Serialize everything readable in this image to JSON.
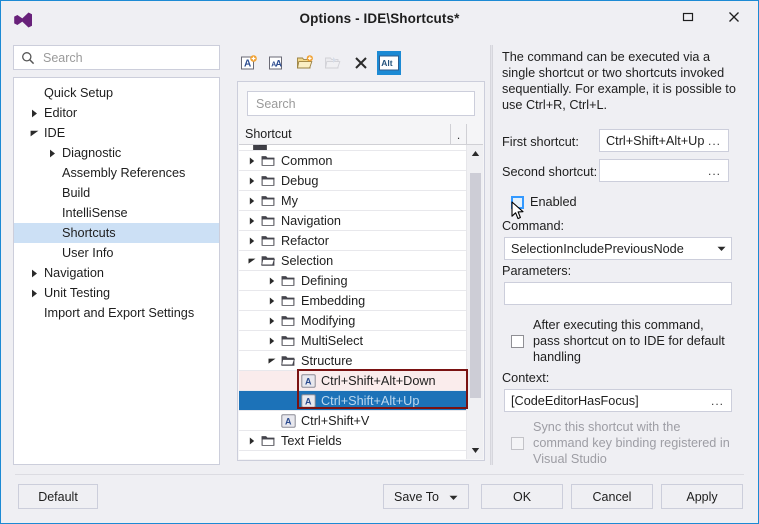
{
  "window": {
    "title": "Options - IDE\\Shortcuts*",
    "logo_icon": "visual-studio-logo",
    "maximize_icon": "maximize-icon",
    "close_icon": "close-icon"
  },
  "nav": {
    "search": {
      "placeholder": "Search",
      "value": "",
      "icon": "search-icon"
    },
    "items": [
      {
        "label": "Quick Setup",
        "indent": 0,
        "expander": "none",
        "selected": false
      },
      {
        "label": "Editor",
        "indent": 0,
        "expander": "collapsed",
        "selected": false
      },
      {
        "label": "IDE",
        "indent": 0,
        "expander": "expanded",
        "selected": false
      },
      {
        "label": "Diagnostic",
        "indent": 1,
        "expander": "collapsed",
        "selected": false
      },
      {
        "label": "Assembly References",
        "indent": 1,
        "expander": "none",
        "selected": false
      },
      {
        "label": "Build",
        "indent": 1,
        "expander": "none",
        "selected": false
      },
      {
        "label": "IntelliSense",
        "indent": 1,
        "expander": "none",
        "selected": false
      },
      {
        "label": "Shortcuts",
        "indent": 1,
        "expander": "none",
        "selected": true
      },
      {
        "label": "User Info",
        "indent": 1,
        "expander": "none",
        "selected": false
      },
      {
        "label": "Navigation",
        "indent": 0,
        "expander": "collapsed",
        "selected": false
      },
      {
        "label": "Unit Testing",
        "indent": 0,
        "expander": "collapsed",
        "selected": false
      },
      {
        "label": "Import and Export Settings",
        "indent": 0,
        "expander": "none",
        "selected": false
      }
    ]
  },
  "middle": {
    "toolbar": [
      {
        "name": "add-shortcut-icon",
        "enabled": true,
        "active": false
      },
      {
        "name": "add-folder-icon",
        "enabled": true,
        "active": false
      },
      {
        "name": "open-folder-icon",
        "enabled": true,
        "active": false
      },
      {
        "name": "copy-shortcut-icon",
        "enabled": false,
        "active": false
      },
      {
        "name": "delete-icon",
        "enabled": true,
        "active": false
      },
      {
        "name": "alt-toggle-icon",
        "enabled": true,
        "active": true,
        "label": "Alt"
      }
    ],
    "search": {
      "placeholder": "Search",
      "value": ""
    },
    "column_header": {
      "main": "Shortcut",
      "secondary": "."
    },
    "tree": [
      {
        "label": "Common",
        "indent": 0,
        "expander": "collapsed",
        "icon": "folder-icon",
        "state": "normal"
      },
      {
        "label": "Debug",
        "indent": 0,
        "expander": "collapsed",
        "icon": "folder-icon",
        "state": "normal"
      },
      {
        "label": "My",
        "indent": 0,
        "expander": "collapsed",
        "icon": "folder-icon",
        "state": "normal"
      },
      {
        "label": "Navigation",
        "indent": 0,
        "expander": "collapsed",
        "icon": "folder-icon",
        "state": "normal"
      },
      {
        "label": "Refactor",
        "indent": 0,
        "expander": "collapsed",
        "icon": "folder-icon",
        "state": "normal"
      },
      {
        "label": "Selection",
        "indent": 0,
        "expander": "expanded",
        "icon": "folder-open-icon",
        "state": "normal"
      },
      {
        "label": "Defining",
        "indent": 1,
        "expander": "collapsed",
        "icon": "folder-icon",
        "state": "normal"
      },
      {
        "label": "Embedding",
        "indent": 1,
        "expander": "collapsed",
        "icon": "folder-icon",
        "state": "normal"
      },
      {
        "label": "Modifying",
        "indent": 1,
        "expander": "collapsed",
        "icon": "folder-icon",
        "state": "normal"
      },
      {
        "label": "MultiSelect",
        "indent": 1,
        "expander": "collapsed",
        "icon": "folder-icon",
        "state": "normal"
      },
      {
        "label": "Structure",
        "indent": 1,
        "expander": "expanded",
        "icon": "folder-open-icon",
        "state": "normal"
      },
      {
        "label": "Ctrl+Shift+Alt+Down",
        "indent": 2,
        "expander": "none",
        "icon": "shortcut-key-icon",
        "state": "highlighted"
      },
      {
        "label": "Ctrl+Shift+Alt+Up",
        "indent": 2,
        "expander": "none",
        "icon": "shortcut-key-icon",
        "state": "selected"
      },
      {
        "label": "Ctrl+Shift+V",
        "indent": 1,
        "expander": "none",
        "icon": "shortcut-key-icon",
        "state": "normal"
      },
      {
        "label": "Text Fields",
        "indent": 0,
        "expander": "collapsed",
        "icon": "folder-icon",
        "state": "normal"
      }
    ],
    "scrollbar": {
      "up_icon": "scroll-up-arrow-icon",
      "down_icon": "scroll-down-arrow-icon"
    }
  },
  "details": {
    "description": "The command can be executed via a single shortcut or two shortcuts invoked sequentially. For example, it is possible to use Ctrl+R, Ctrl+L.",
    "first_shortcut": {
      "label": "First shortcut:",
      "value": "Ctrl+Shift+Alt+Up",
      "browse": "..."
    },
    "second_shortcut": {
      "label": "Second shortcut:",
      "value": "",
      "browse": "..."
    },
    "enabled_checkbox": {
      "label": "Enabled",
      "checked": false,
      "hovered": true
    },
    "command": {
      "label": "Command:",
      "value": "SelectionIncludePreviousNode",
      "arrow_icon": "chevron-down-icon"
    },
    "parameters": {
      "label": "Parameters:",
      "value": "",
      "placeholder": ""
    },
    "pass_on_checkbox": {
      "label": "After executing this command, pass shortcut on to IDE for default handling",
      "checked": false
    },
    "context": {
      "label": "Context:",
      "value": "[CodeEditorHasFocus]",
      "browse": "..."
    },
    "sync_checkbox": {
      "label": "Sync this shortcut with the command key binding registered in Visual Studio",
      "checked": false,
      "disabled": true
    }
  },
  "footer": {
    "default": "Default",
    "save_to": "Save To",
    "save_to_arrow_icon": "chevron-down-icon",
    "ok": "OK",
    "cancel": "Cancel",
    "apply": "Apply"
  },
  "colors": {
    "accent": "#1c8ad4",
    "selection_blue": "#1c72b8",
    "nav_selection": "#cce0f5",
    "marker_red": "#7a1212",
    "highlight_pink": "#faecec",
    "dialog_bg": "#efeff3"
  },
  "cursor": {
    "icon": "mouse-pointer-icon"
  }
}
